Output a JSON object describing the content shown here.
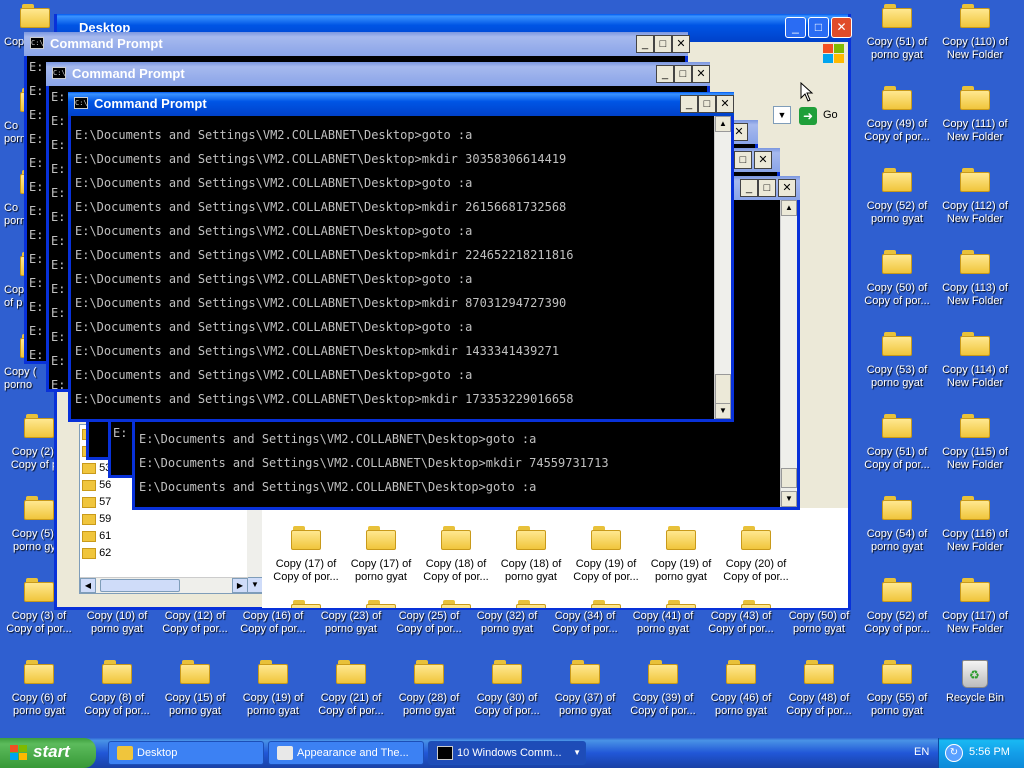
{
  "desktop": {
    "left_column": [
      {
        "label": "Copy (2) of\nCopy of p..."
      },
      {
        "label": "Copy (5) of\nporno gyat"
      },
      {
        "label": "Copy (3) of\nCopy of por..."
      }
    ],
    "partial_labels": [
      "Copy",
      "Co\nporno",
      "Co\nporno",
      "Cop\nof p",
      "Copy (\nporno"
    ],
    "row_bottom": [
      {
        "label": "Copy (6) of\nporno gyat"
      },
      {
        "label": "Copy (8) of\nCopy of por..."
      },
      {
        "label": "Copy (15) of\nporno gyat"
      },
      {
        "label": "Copy (19) of\nporno gyat"
      },
      {
        "label": "Copy (21) of\nCopy of por..."
      },
      {
        "label": "Copy (28) of\nporno gyat"
      },
      {
        "label": "Copy (30) of\nCopy of por..."
      },
      {
        "label": "Copy (37) of\nporno gyat"
      },
      {
        "label": "Copy (39) of\nCopy of por..."
      },
      {
        "label": "Copy (46) of\nporno gyat"
      },
      {
        "label": "Copy (48) of\nCopy of por..."
      },
      {
        "label": "Copy (55) of\nporno gyat"
      }
    ],
    "row_middle": [
      {
        "label": "Copy (10) of\nporno gyat"
      },
      {
        "label": "Copy (12) of\nCopy of por..."
      },
      {
        "label": "Copy (16) of\nCopy of por..."
      },
      {
        "label": "Copy (23) of\nporno gyat"
      },
      {
        "label": "Copy (25) of\nCopy of por..."
      },
      {
        "label": "Copy (32) of\nporno gyat"
      },
      {
        "label": "Copy (34) of\nCopy of por..."
      },
      {
        "label": "Copy (41) of\nporno gyat"
      },
      {
        "label": "Copy (43) of\nCopy of por..."
      },
      {
        "label": "Copy (50) of\nporno gyat"
      },
      {
        "label": "Copy (52) of\nCopy of por..."
      }
    ],
    "right_column_a": [
      {
        "label": "Copy (51) of\nporno gyat"
      },
      {
        "label": "Copy (49) of\nCopy of por..."
      },
      {
        "label": "Copy (52) of\nporno gyat"
      },
      {
        "label": "Copy (50) of\nCopy of por..."
      },
      {
        "label": "Copy (53) of\nporno gyat"
      },
      {
        "label": "Copy (51) of\nCopy of por..."
      },
      {
        "label": "Copy (54) of\nporno gyat"
      }
    ],
    "right_column_b": [
      {
        "label": "Copy (110) of\nNew Folder"
      },
      {
        "label": "Copy (111) of\nNew Folder"
      },
      {
        "label": "Copy (112) of\nNew Folder"
      },
      {
        "label": "Copy (113) of\nNew Folder"
      },
      {
        "label": "Copy (114) of\nNew Folder"
      },
      {
        "label": "Copy (115) of\nNew Folder"
      },
      {
        "label": "Copy (116) of\nNew Folder"
      },
      {
        "label": "Copy (117) of\nNew Folder"
      }
    ],
    "recycle_bin": "Recycle Bin"
  },
  "explorer": {
    "title": "Desktop",
    "go_label": "Go",
    "tree_items": [
      "51",
      "52",
      "53",
      "56",
      "57",
      "59",
      "61",
      "62"
    ],
    "content_icons": [
      {
        "label": "Copy (17) of\nCopy of por..."
      },
      {
        "label": "Copy (17) of\nporno gyat"
      },
      {
        "label": "Copy (18) of\nCopy of por..."
      },
      {
        "label": "Copy (18) of\nporno gyat"
      },
      {
        "label": "Copy (19) of\nCopy of por..."
      },
      {
        "label": "Copy (19) of\nporno gyat"
      },
      {
        "label": "Copy (20) of\nCopy of por..."
      }
    ]
  },
  "cmd": {
    "title": "Command Prompt",
    "front_lines": [
      "E:\\Documents and Settings\\VM2.COLLABNET\\Desktop>goto :a",
      "E:\\Documents and Settings\\VM2.COLLABNET\\Desktop>mkdir 30358306614419",
      "E:\\Documents and Settings\\VM2.COLLABNET\\Desktop>goto :a",
      "E:\\Documents and Settings\\VM2.COLLABNET\\Desktop>mkdir 26156681732568",
      "E:\\Documents and Settings\\VM2.COLLABNET\\Desktop>goto :a",
      "E:\\Documents and Settings\\VM2.COLLABNET\\Desktop>mkdir 224652218211816",
      "E:\\Documents and Settings\\VM2.COLLABNET\\Desktop>goto :a",
      "E:\\Documents and Settings\\VM2.COLLABNET\\Desktop>mkdir 87031294727390",
      "E:\\Documents and Settings\\VM2.COLLABNET\\Desktop>goto :a",
      "E:\\Documents and Settings\\VM2.COLLABNET\\Desktop>mkdir 1433341439271",
      "E:\\Documents and Settings\\VM2.COLLABNET\\Desktop>goto :a",
      "E:\\Documents and Settings\\VM2.COLLABNET\\Desktop>mkdir 173353229016658"
    ],
    "back_lines": [
      "E:\\Documents and Settings\\VM2.COLLABNET\\Desktop>goto :a",
      "E:\\Documents and Settings\\VM2.COLLABNET\\Desktop>mkdir 74559731713",
      "E:\\Documents and Settings\\VM2.COLLABNET\\Desktop>goto :a"
    ],
    "partial_prefix": "E:"
  },
  "taskbar": {
    "start_label": "start",
    "buttons": [
      {
        "label": "Desktop"
      },
      {
        "label": "Appearance and The..."
      },
      {
        "label": "10 Windows Comm..."
      }
    ],
    "language": "EN",
    "clock": "5:56 PM"
  }
}
